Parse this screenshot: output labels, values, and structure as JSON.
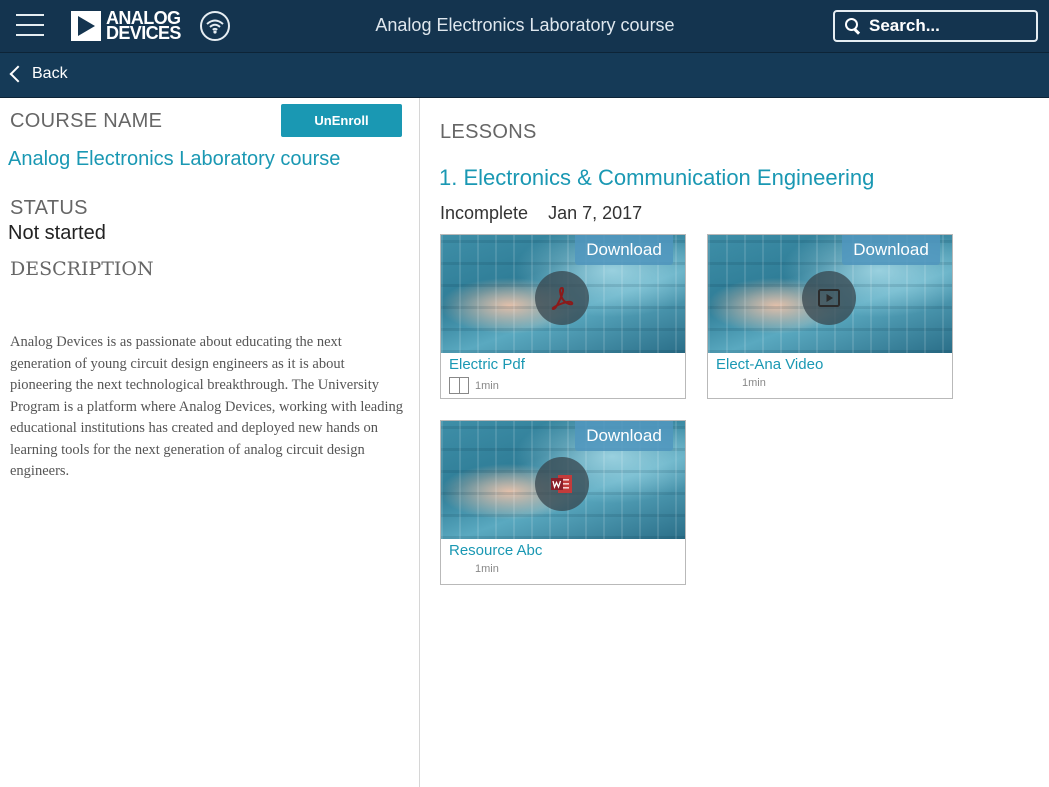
{
  "header": {
    "logo_line1": "ANALOG",
    "logo_line2": "DEVICES",
    "title": "Analog Electronics Laboratory course",
    "search_placeholder": "Search..."
  },
  "nav": {
    "back_label": "Back"
  },
  "course": {
    "name_label": "COURSE NAME",
    "unenroll_label": "UnEnroll",
    "name": "Analog Electronics Laboratory course",
    "status_label": "STATUS",
    "status": "Not started",
    "description_label": "DESCRIPTION",
    "description": "Analog Devices is as passionate about educating the next generation of young circuit design engineers as it is about pioneering the next technological breakthrough. The University Program is a platform where Analog Devices, working with leading educational institutions has created and deployed new hands on learning tools for the next generation of analog circuit design engineers."
  },
  "lessons": {
    "label": "LESSONS",
    "section_title": "1. Electronics & Communication Engineering",
    "status": "Incomplete",
    "date": "Jan 7, 2017",
    "items": [
      {
        "download_label": "Download",
        "title": "Electric Pdf",
        "duration": "1min",
        "icon": "pdf-icon"
      },
      {
        "download_label": "Download",
        "title": "Elect-Ana Video",
        "duration": "1min",
        "icon": "video-icon"
      },
      {
        "download_label": "Download",
        "title": "Resource Abc",
        "duration": "1min",
        "icon": "word-document-icon"
      }
    ]
  },
  "colors": {
    "header_bg": "#14344f",
    "accent": "#1a98b3",
    "download_bg": "#5096be"
  }
}
